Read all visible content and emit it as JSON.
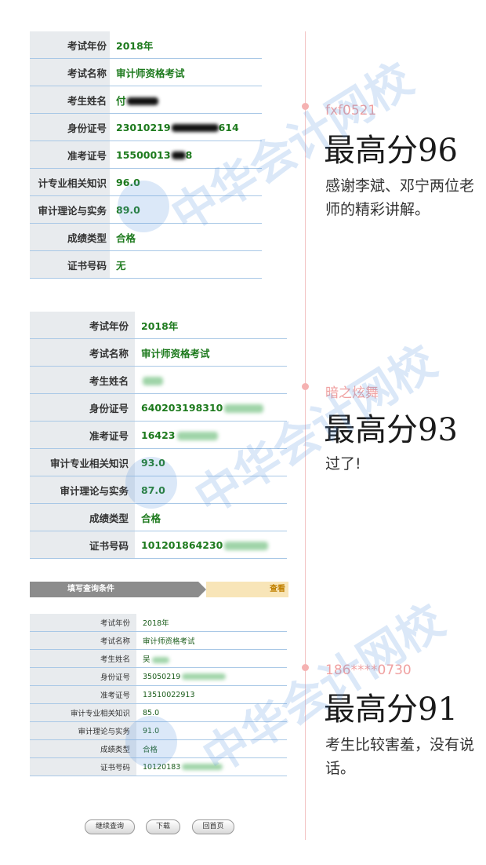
{
  "result1": {
    "rows": [
      {
        "label": "考试年份",
        "value": "2018年"
      },
      {
        "label": "考试名称",
        "value": "审计师资格考试"
      },
      {
        "label": "考生姓名",
        "value": "付"
      },
      {
        "label": "身份证号",
        "value": "23010219",
        "value_tail": "614"
      },
      {
        "label": "准考证号",
        "value": "15500013",
        "value_tail": "8"
      },
      {
        "label": "计专业相关知识",
        "value": "96.0"
      },
      {
        "label": "审计理论与实务",
        "value": "89.0"
      },
      {
        "label": "成绩类型",
        "value": "合格"
      },
      {
        "label": "证书号码",
        "value": "无"
      }
    ]
  },
  "result2": {
    "rows": [
      {
        "label": "考试年份",
        "value": "2018年"
      },
      {
        "label": "考试名称",
        "value": "审计师资格考试"
      },
      {
        "label": "考生姓名",
        "value": ""
      },
      {
        "label": "身份证号",
        "value": "640203198310"
      },
      {
        "label": "准考证号",
        "value": "16423"
      },
      {
        "label": "审计专业相关知识",
        "value": "93.0"
      },
      {
        "label": "审计理论与实务",
        "value": "87.0"
      },
      {
        "label": "成绩类型",
        "value": "合格"
      },
      {
        "label": "证书号码",
        "value": "101201864230"
      }
    ]
  },
  "query_steps": {
    "step1": "填写查询条件",
    "step2": "查看"
  },
  "result3": {
    "rows": [
      {
        "label": "考试年份",
        "value": "2018年"
      },
      {
        "label": "考试名称",
        "value": "审计师资格考试"
      },
      {
        "label": "考生姓名",
        "value": "吴"
      },
      {
        "label": "身份证号",
        "value": "35050219"
      },
      {
        "label": "准考证号",
        "value": "13510022913"
      },
      {
        "label": "审计专业相关知识",
        "value": "85.0"
      },
      {
        "label": "审计理论与实务",
        "value": "91.0"
      },
      {
        "label": "成绩类型",
        "value": "合格"
      },
      {
        "label": "证书号码",
        "value": "10120183"
      }
    ]
  },
  "buttons": {
    "continue": "继续查询",
    "download": "下载",
    "home": "回首页"
  },
  "testimonials": [
    {
      "user": "fxf0521",
      "score": "最高分96",
      "comment": "感谢李斌、邓宁两位老师的精彩讲解。"
    },
    {
      "user": "暗之炫舞",
      "score": "最高分93",
      "comment": "过了!"
    },
    {
      "user": "186****0730",
      "score": "最高分91",
      "comment": "考生比较害羞，没有说话。"
    }
  ],
  "watermark": "中华会计网校",
  "colors": {
    "value_green": "#1d7a1d",
    "label_bg": "#e8ebee",
    "row_line": "#a9c8e6",
    "timeline": "#f2c4c4",
    "username": "#f0a0a0"
  }
}
